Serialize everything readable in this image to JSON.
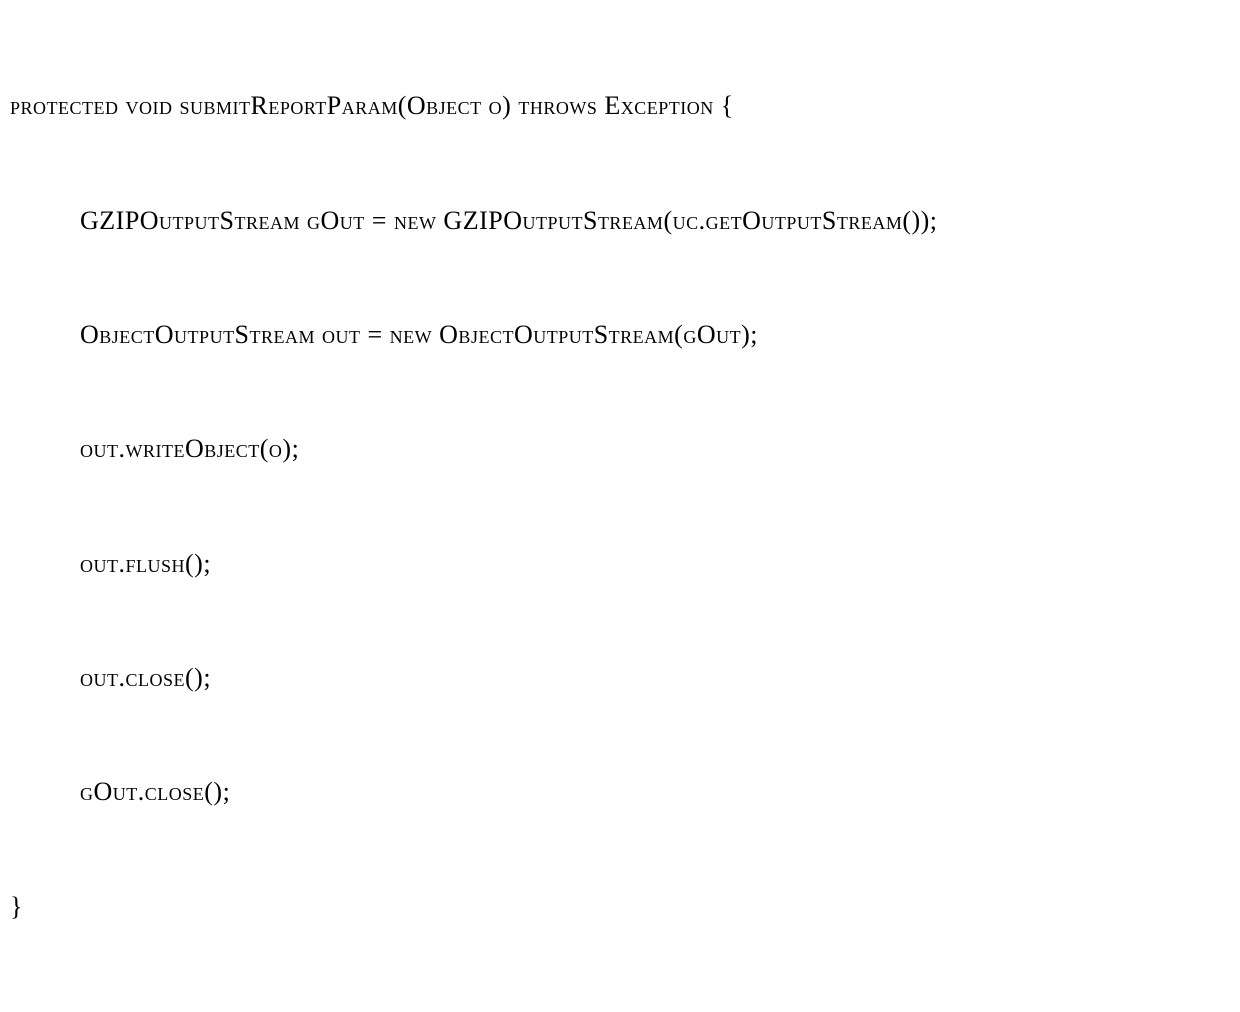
{
  "code": {
    "lines": [
      {
        "text": "protected void submitReportParam(Object o) throws Exception {",
        "indent": false
      },
      {
        "text": "GZIPOutputStream gOut = new GZIPOutputStream(uc.getOutputStream());",
        "indent": true
      },
      {
        "text": "ObjectOutputStream out = new ObjectOutputStream(gOut);",
        "indent": true
      },
      {
        "text": "out.writeObject(o);",
        "indent": true
      },
      {
        "text": "out.flush();",
        "indent": true
      },
      {
        "text": "out.close();",
        "indent": true
      },
      {
        "text": "gOut.close();",
        "indent": true
      },
      {
        "text": "}",
        "indent": false
      }
    ]
  }
}
